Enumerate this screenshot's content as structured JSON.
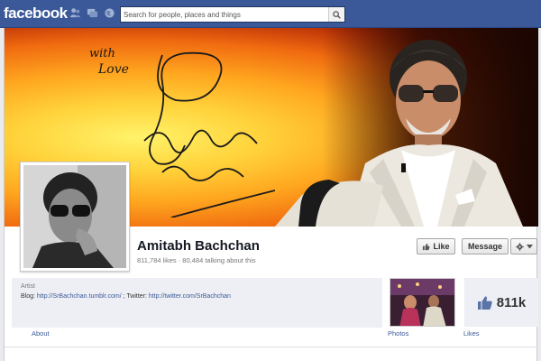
{
  "topbar": {
    "logo": "facebook",
    "search_placeholder": "Search for people, places and things"
  },
  "cover": {
    "signature_text": "with Love"
  },
  "profile": {
    "name": "Amitabh Bachchan",
    "stats": "811,784 likes · 80,484 talking about this"
  },
  "actions": {
    "like_label": "Like",
    "message_label": "Message"
  },
  "info": {
    "category": "Artist",
    "blog_prefix": "Blog: ",
    "blog_link": "http://SrBachchan.tumblr.com/",
    "separator": " ; Twitter: ",
    "twitter_link": "http://twitter.com/SrBachchan"
  },
  "tabs": {
    "about": "About",
    "photos": "Photos",
    "likes": "Likes",
    "likes_count": "811k"
  },
  "colors": {
    "brand": "#3b5998"
  }
}
